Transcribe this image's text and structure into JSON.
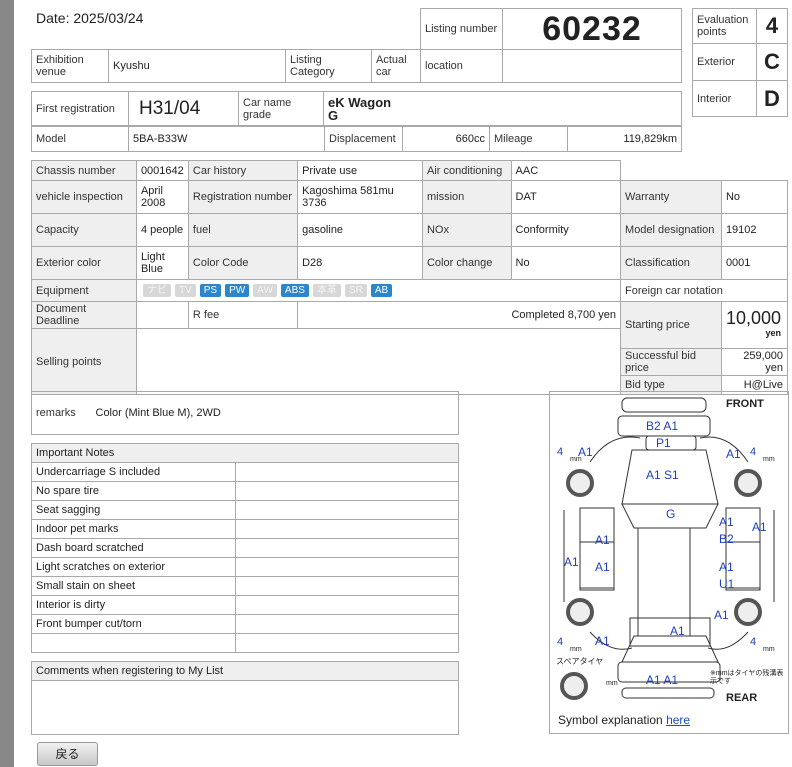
{
  "header": {
    "date_label": "Date:",
    "date_value": "2025/03/24",
    "listing_number_label": "Listing number",
    "listing_number": "60232",
    "exhibition_venue_label": "Exhibition venue",
    "exhibition_venue": "Kyushu",
    "listing_category_label": "Listing Category",
    "actual_car_label": "Actual car",
    "location_label": "location",
    "location_value": ""
  },
  "evaluation": {
    "evaluation_points_label": "Evaluation points",
    "evaluation_points": "4",
    "exterior_label": "Exterior",
    "exterior": "C",
    "interior_label": "Interior",
    "interior": "D"
  },
  "car": {
    "first_registration_label": "First registration",
    "first_registration": "H31/04",
    "car_name_label": "Car name grade",
    "car_name": "eK Wagon",
    "grade": "G",
    "model_label": "Model",
    "model": "5BA-B33W",
    "displacement_label": "Displacement",
    "displacement": "660cc",
    "mileage_label": "Mileage",
    "mileage": "119,829km"
  },
  "details": {
    "chassis_number_label": "Chassis number",
    "chassis_number": "0001642",
    "car_history_label": "Car history",
    "car_history": "Private use",
    "air_conditioning_label": "Air conditioning",
    "air_conditioning": "AAC",
    "vehicle_inspection_label": "vehicle inspection",
    "vehicle_inspection": "April 2008",
    "registration_number_label": "Registration number",
    "registration_number": "Kagoshima 581mu 3736",
    "mission_label": "mission",
    "mission": "DAT",
    "warranty_label": "Warranty",
    "warranty": "No",
    "capacity_label": "Capacity",
    "capacity": "4 people",
    "fuel_label": "fuel",
    "fuel": "gasoline",
    "nox_label": "NOx",
    "nox": "Conformity",
    "model_designation_label": "Model designation",
    "model_designation": "19102",
    "exterior_color_label": "Exterior color",
    "exterior_color": "Light Blue",
    "color_code_label": "Color Code",
    "color_code": "D28",
    "color_change_label": "Color change",
    "color_change": "No",
    "classification_label": "Classification",
    "classification": "0001",
    "equipment_label": "Equipment",
    "equipment": [
      {
        "label": "ナビ",
        "on": false
      },
      {
        "label": "TV",
        "on": false
      },
      {
        "label": "PS",
        "on": true
      },
      {
        "label": "PW",
        "on": true
      },
      {
        "label": "AW",
        "on": false
      },
      {
        "label": "ABS",
        "on": true
      },
      {
        "label": "本革",
        "on": false
      },
      {
        "label": "SR",
        "on": false
      },
      {
        "label": "AB",
        "on": true
      }
    ],
    "foreign_car_label": "Foreign car notation",
    "document_deadline_label": "Document Deadline",
    "r_fee_label": "R fee",
    "r_fee": "Completed 8,700 yen",
    "starting_price_label": "Starting price",
    "starting_price": "10,000",
    "starting_price_unit": "yen",
    "selling_points_label": "Selling points",
    "successful_bid_label": "Successful bid price",
    "successful_bid": "259,000 yen",
    "bid_type_label": "Bid type",
    "bid_type": "H@Live"
  },
  "remarks": {
    "label": "remarks",
    "value": "Color (Mint Blue M), 2WD"
  },
  "important_notes": {
    "title": "Important Notes",
    "items": [
      "Undercarriage S included",
      "No spare tire",
      "Seat sagging",
      "Indoor pet marks",
      "Dash board scratched",
      "Light scratches on exterior",
      "Small stain on sheet",
      "Interior is dirty",
      "Front bumper cut/torn"
    ]
  },
  "comments": {
    "label": "Comments when registering to My List"
  },
  "diagram": {
    "front_label": "FRONT",
    "rear_label": "REAR",
    "spare_label": "スペアタイヤ",
    "tire_note": "※mmはタイヤの残溝表示です",
    "tire_unit": "mm",
    "tire_fl": "4",
    "tire_fr": "4",
    "tire_rl": "4",
    "tire_rr": "4",
    "marks": {
      "front_bumper": "B2 A1",
      "front_panel": "P1",
      "hood": "A1 S1",
      "roof": "G",
      "left_front_fender": "A1",
      "right_front_fender": "A1",
      "left_front_door": "A1",
      "left_rear_door": "A1",
      "left_side": "A1",
      "right_front_door_1": "A1",
      "right_front_door_2": "B2",
      "right_rear_door_1": "A1",
      "right_rear_door_2": "U1",
      "right_side": "A1",
      "left_rear_fender": "A1",
      "right_rear_fender": "A1",
      "rear_gate": "A1",
      "rear_bumper": "A1 A1"
    },
    "symbol_label": "Symbol explanation",
    "symbol_link": "here"
  },
  "footer": {
    "back_button": "戻る"
  },
  "colors": {
    "accent": "#2c86c9",
    "diagram_blue": "#1f3fbf",
    "label_bg": "#efefef",
    "border": "#a9a9a9"
  }
}
